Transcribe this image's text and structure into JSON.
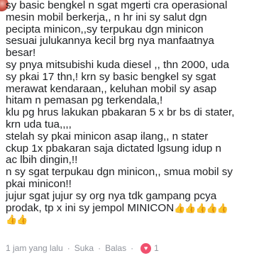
{
  "comment": {
    "lines": [
      "sy basic bengkel n sgat mgerti cra operasional",
      "mesin mobil berkerja,, n hr ini sy salut dgn",
      "pecipta minicon,,sy terpukau dgn minicon",
      "sesuai julukannya kecil brg nya manfaatnya",
      "besar!",
      "sy pnya mitsubishi kuda diesel ,, thn 2000, uda",
      "sy pkai 17 thn,! krn sy basic bengkel sy sgat",
      "merawat kendaraan,, keluhan mobil sy asap",
      "hitam n pemasan pg terkendala,!",
      "klu pg hrus lakukan pbakaran 5 x br bs di stater,",
      "krn uda tua,,,,",
      "stelah sy pkai minicon asap ilang,, n stater",
      "ckup 1x pbakaran saja dictated lgsung idup n",
      "ac lbih dingin,!!",
      "n sy sgat terpukau dgn minicon,, smua mobil sy",
      "pkai minicon!!",
      "jujur sgat jujur sy org nya tdk gampang pcya",
      "prodak, tp x ini sy jempol MINICON"
    ],
    "thumbs_inline": "👍👍👍👍👍",
    "thumbs_next_line": "👍👍"
  },
  "meta": {
    "time": "1 jam yang lalu",
    "separator": "·",
    "like_label": "Suka",
    "reply_label": "Balas",
    "reaction_count": "1",
    "heart_icon": "heart-icon",
    "heart_color": "#f0506e"
  }
}
